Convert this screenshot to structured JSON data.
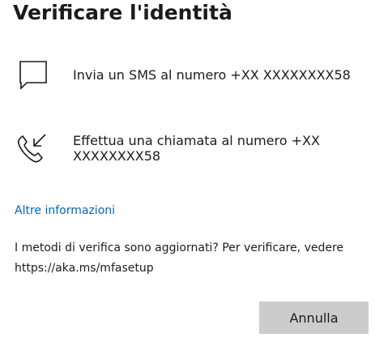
{
  "page": {
    "title": "Verificare l'identità"
  },
  "options": [
    {
      "icon": "message-icon",
      "label": "Invia un SMS al numero +XX XXXXXXXX58"
    },
    {
      "icon": "phone-call-icon",
      "label": "Effettua una chiamata al numero +XX XXXXXXXX58"
    }
  ],
  "more_info": {
    "label": "Altre informazioni"
  },
  "info_text": "I metodi di verifica sono aggiornati? Per verificare, vedere https://aka.ms/mfasetup",
  "actions": {
    "cancel_label": "Annulla"
  },
  "colors": {
    "link": "#0067b8",
    "button_bg": "#cccccc",
    "text": "#1b1b1b"
  }
}
